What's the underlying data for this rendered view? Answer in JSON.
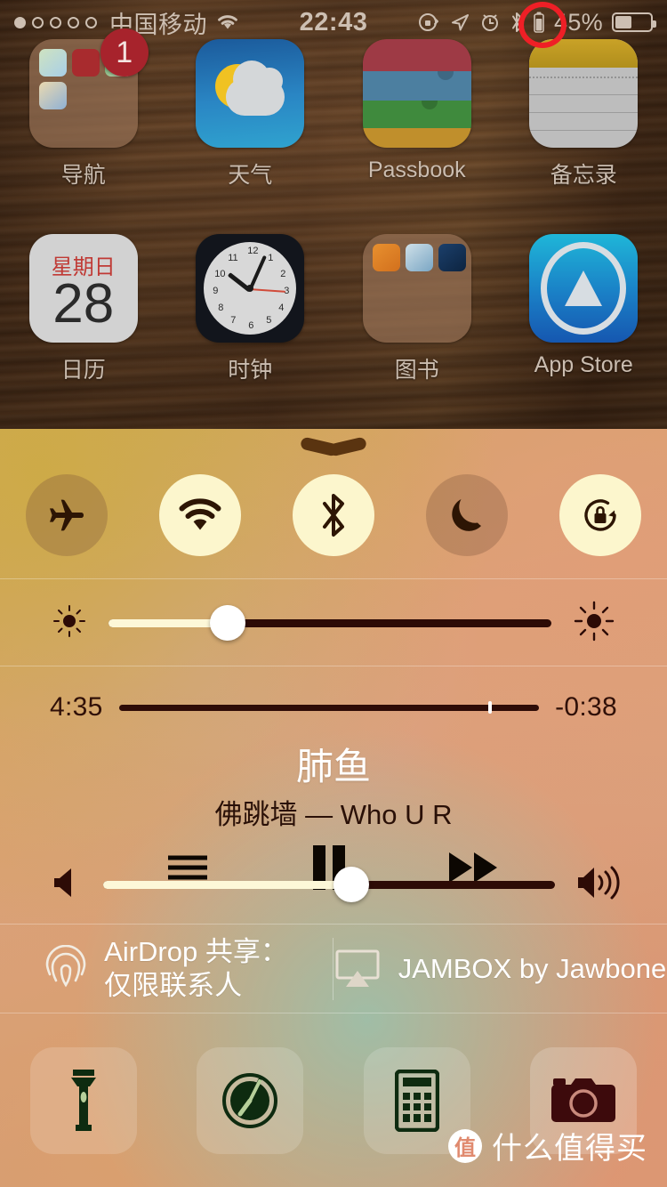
{
  "status_bar": {
    "signal_dots": [
      true,
      false,
      false,
      false,
      false
    ],
    "carrier": "中国移动",
    "wifi_icon": "wifi-icon",
    "time": "22:43",
    "icons": [
      "rotation-lock-icon",
      "location-arrow-icon",
      "alarm-clock-icon",
      "bluetooth-icon",
      "bluetooth-battery-icon"
    ],
    "battery_percent": "45%",
    "battery_level": 45
  },
  "annotation": {
    "shape": "red-ellipse",
    "color": "#ef1f26",
    "target": "bluetooth-battery-indicator"
  },
  "home_screen": {
    "rows": [
      [
        {
          "label": "导航",
          "icon": "navigation-folder-icon",
          "badge": "1"
        },
        {
          "label": "天气",
          "icon": "weather-app-icon",
          "badge": ""
        },
        {
          "label": "Passbook",
          "icon": "passbook-app-icon",
          "badge": ""
        },
        {
          "label": "备忘录",
          "icon": "notes-app-icon",
          "badge": ""
        }
      ],
      [
        {
          "label": "日历",
          "icon": "calendar-app-icon",
          "day_of_week": "星期日",
          "day": "28"
        },
        {
          "label": "时钟",
          "icon": "clock-app-icon"
        },
        {
          "label": "图书",
          "icon": "books-folder-icon"
        },
        {
          "label": "App Store",
          "icon": "app-store-icon"
        }
      ],
      [
        {
          "label": "",
          "icon": "evernote-app-icon"
        },
        {
          "label": "",
          "icon": "weibo-app-icon"
        },
        {
          "label": "",
          "icon": "qq-app-icon"
        },
        {
          "label": "",
          "icon": "settings-app-icon"
        }
      ]
    ]
  },
  "control_center": {
    "grabber_icon": "chevron-down-grabber",
    "toggles": [
      {
        "name": "airplane-mode",
        "icon": "airplane-icon",
        "state": "off"
      },
      {
        "name": "wifi",
        "icon": "wifi-icon",
        "state": "on"
      },
      {
        "name": "bluetooth",
        "icon": "bluetooth-icon",
        "state": "on"
      },
      {
        "name": "do-not-disturb",
        "icon": "moon-icon",
        "state": "off"
      },
      {
        "name": "rotation-lock",
        "icon": "rotation-lock-icon",
        "state": "on"
      }
    ],
    "brightness": {
      "value_percent": 27,
      "low_icon": "brightness-low-icon",
      "high_icon": "brightness-high-icon"
    },
    "music": {
      "elapsed": "4:35",
      "remaining": "-0:38",
      "progress_percent": 88,
      "title": "肺鱼",
      "subtitle": "佛跳墙 — Who U R",
      "controls": [
        {
          "name": "playlist-button",
          "icon": "list-icon"
        },
        {
          "name": "play-pause-button",
          "icon": "pause-icon"
        },
        {
          "name": "next-track-button",
          "icon": "fast-forward-icon"
        }
      ],
      "volume": {
        "value_percent": 55,
        "low_icon": "volume-low-icon",
        "high_icon": "volume-high-icon"
      }
    },
    "airdrop": {
      "icon": "airdrop-icon",
      "line1": "AirDrop 共享：",
      "line2": "仅限联系人"
    },
    "airplay": {
      "icon": "airplay-icon",
      "label": "JAMBOX by Jawbone"
    },
    "shortcuts": [
      {
        "name": "flashlight-shortcut",
        "icon": "flashlight-icon"
      },
      {
        "name": "timer-shortcut",
        "icon": "timer-icon"
      },
      {
        "name": "calculator-shortcut",
        "icon": "calculator-icon"
      },
      {
        "name": "camera-shortcut",
        "icon": "camera-icon"
      }
    ]
  },
  "watermark": {
    "badge": "值",
    "text": "什么值得买"
  }
}
